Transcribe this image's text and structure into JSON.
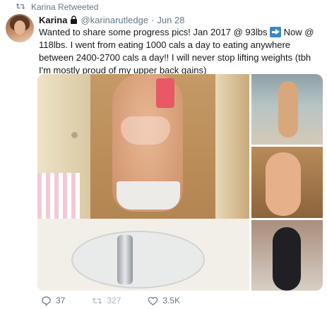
{
  "retweet_context": {
    "label": "Karina Retweeted"
  },
  "tweet": {
    "display_name": "Karina",
    "handle": "@karinarutledge",
    "separator": "·",
    "time": "Jun 28",
    "text_part1": "Wanted to share some progress pics! Jan 2017 @ 93lbs ",
    "text_emoji_icon": "right-arrow-emoji-icon",
    "text_part2": " Now @ 118lbs. I went from eating 1000 cals a day to eating anywhere between 2400-2700 cals a day!! I will never stop lifting weights (tbh I'm mostly proud of my upper back gains)"
  },
  "media": {
    "count": 4
  },
  "actions": {
    "reply_count": "37",
    "retweet_count": "327",
    "like_count": "3.5K"
  },
  "colors": {
    "secondary_text": "#657786",
    "primary_text": "#14171a"
  }
}
